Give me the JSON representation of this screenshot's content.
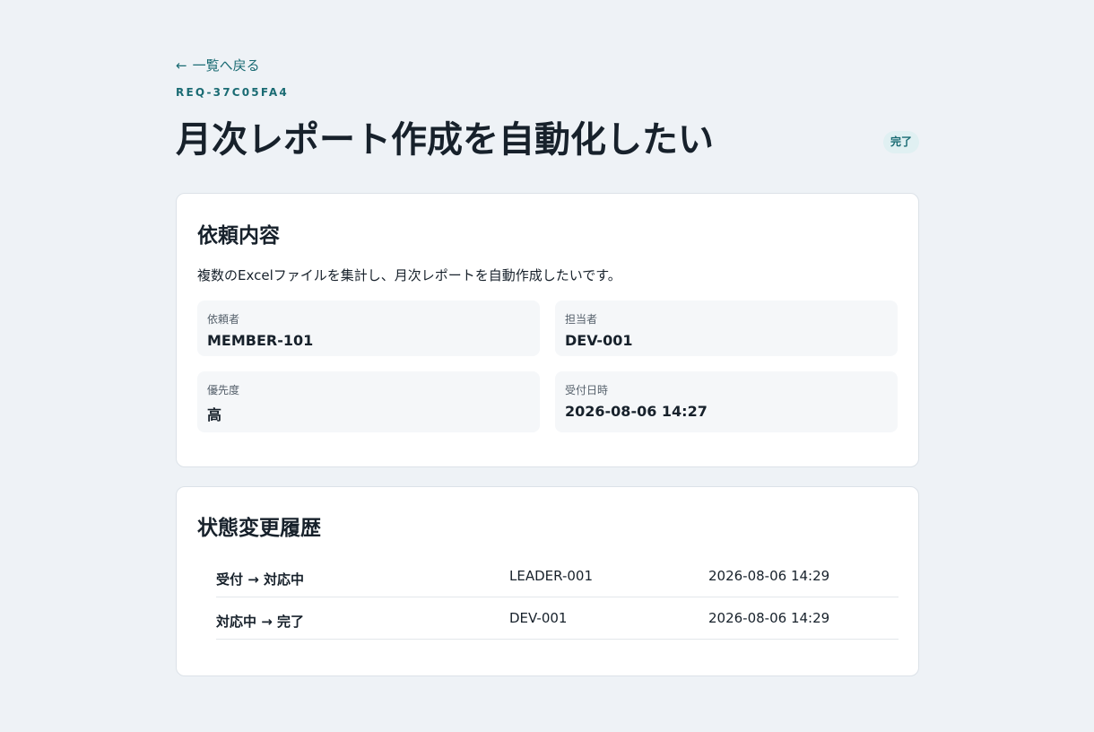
{
  "back_link": {
    "icon": "arrow-left-icon",
    "arrow": "←",
    "label": "一覧へ戻る"
  },
  "request": {
    "id": "REQ-37C05FA4",
    "title": "月次レポート作成を自動化したい",
    "status": "完了"
  },
  "details": {
    "heading": "依頼内容",
    "description": "複数のExcelファイルを集計し、月次レポートを自動作成したいです。",
    "fields": [
      {
        "label": "依頼者",
        "value": "MEMBER-101"
      },
      {
        "label": "担当者",
        "value": "DEV-001"
      },
      {
        "label": "優先度",
        "value": "高"
      },
      {
        "label": "受付日時",
        "value": "2026-08-06 14:27"
      }
    ]
  },
  "history": {
    "heading": "状態変更履歴",
    "rows": [
      {
        "transition": "受付 → 対応中",
        "actor": "LEADER-001",
        "time": "2026-08-06 14:29"
      },
      {
        "transition": "対応中 → 完了",
        "actor": "DEV-001",
        "time": "2026-08-06 14:29"
      }
    ]
  },
  "colors": {
    "background": "#eef2f6",
    "accent": "#1a6b73",
    "badge_bg": "#e0f0f2",
    "card": "#ffffff",
    "field_bg": "#f5f7f9"
  }
}
